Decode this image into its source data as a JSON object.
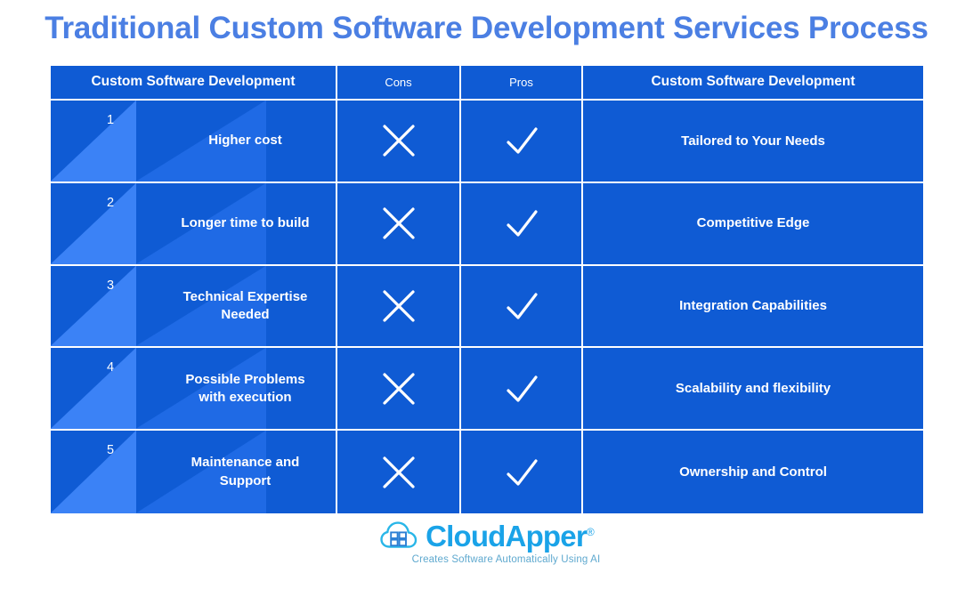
{
  "page": {
    "title": "Traditional Custom Software Development Services Process",
    "background": "#ffffff",
    "title_color": "#4b7fe3"
  },
  "theme": {
    "cell_blue": "#0f5bd4",
    "triangle_light": "#3b82f6",
    "triangle_mid": "#1f6ae5",
    "text_white": "#ffffff",
    "logo_blue": "#1aa3e8",
    "logo_tagline_color": "#5fa9cf"
  },
  "table": {
    "headers": [
      {
        "label": "Custom Software Development",
        "emphasis": "large"
      },
      {
        "label": "Cons",
        "emphasis": "small"
      },
      {
        "label": "Pros",
        "emphasis": "small"
      },
      {
        "label": "Custom Software Development",
        "emphasis": "large"
      }
    ],
    "rows": [
      {
        "number": "1",
        "con": "Higher cost",
        "cons_icon": "cross-icon",
        "pros_icon": "check-icon",
        "pro": "Tailored to Your Needs"
      },
      {
        "number": "2",
        "con": "Longer time to build",
        "cons_icon": "cross-icon",
        "pros_icon": "check-icon",
        "pro": "Competitive Edge"
      },
      {
        "number": "3",
        "con": "Technical Expertise\nNeeded",
        "cons_icon": "cross-icon",
        "pros_icon": "check-icon",
        "pro": "Integration Capabilities"
      },
      {
        "number": "4",
        "con": "Possible Problems\nwith execution",
        "cons_icon": "cross-icon",
        "pros_icon": "check-icon",
        "pro": "Scalability and flexibility"
      },
      {
        "number": "5",
        "con": "Maintenance and\nSupport",
        "cons_icon": "cross-icon",
        "pros_icon": "check-icon",
        "pro": "Ownership and Control"
      }
    ]
  },
  "logo": {
    "icon": "cloud-grid-icon",
    "name_part1": "Cloud",
    "name_part2": "Apper",
    "registered": "®",
    "tagline": "Creates Software Automatically Using AI"
  }
}
